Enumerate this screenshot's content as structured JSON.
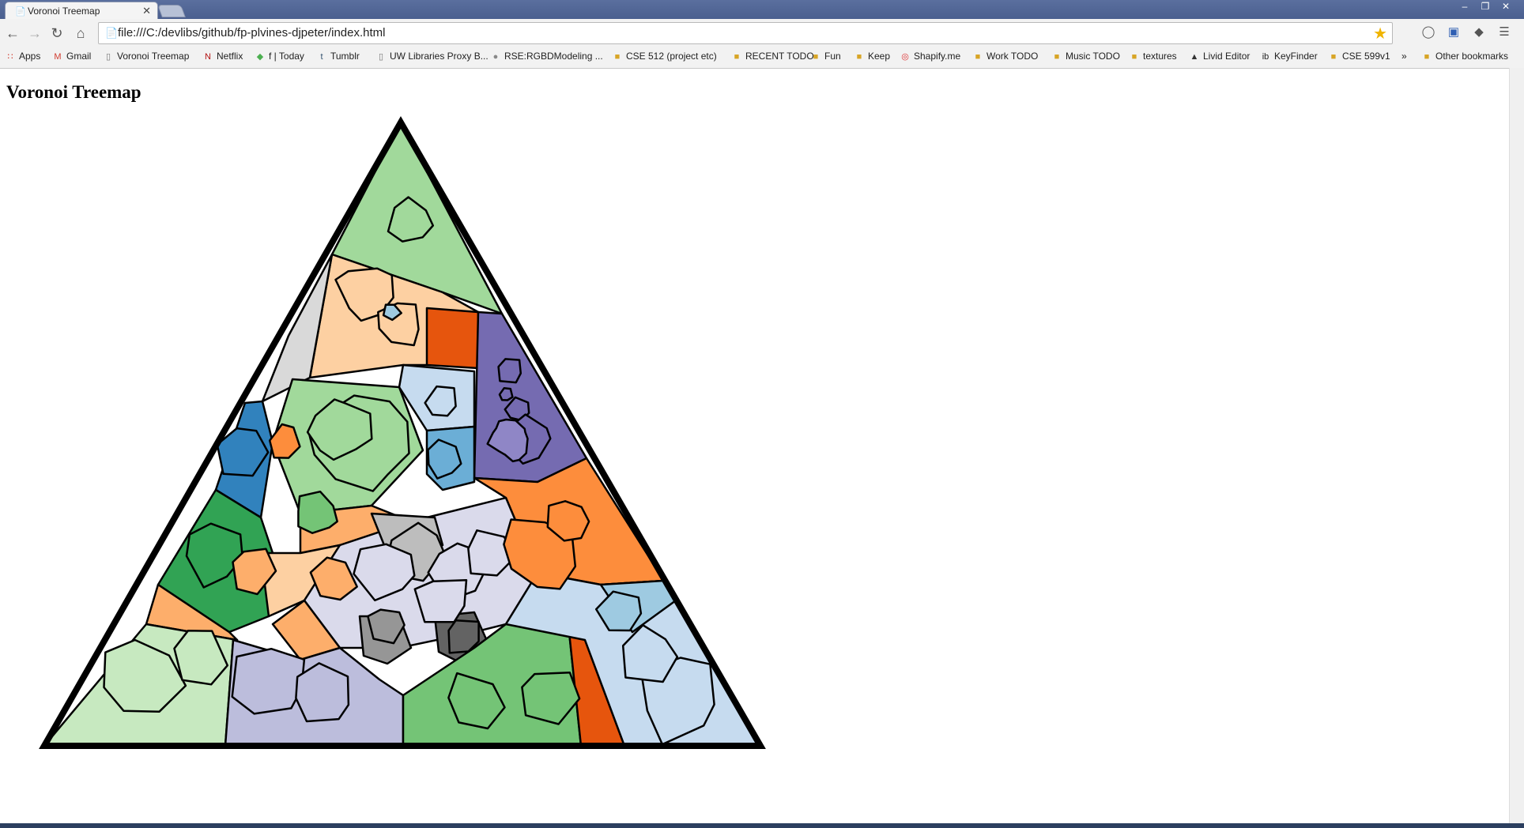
{
  "browser": {
    "tab_title": "Voronoi Treemap",
    "url": "file:///C:/devlibs/github/fp-plvines-djpeter/index.html"
  },
  "bookmarks": [
    {
      "label": "Apps",
      "icon": "apps-grid-icon"
    },
    {
      "label": "Gmail",
      "icon": "gmail-icon"
    },
    {
      "label": "Voronoi Treemap",
      "icon": "page-icon"
    },
    {
      "label": "Netflix",
      "icon": "netflix-icon"
    },
    {
      "label": "f | Today",
      "icon": "feedly-icon"
    },
    {
      "label": "Tumblr",
      "icon": "tumblr-icon"
    },
    {
      "label": "UW Libraries Proxy B...",
      "icon": "page-icon"
    },
    {
      "label": "RSE:RGBDModeling ...",
      "icon": "globe-icon"
    },
    {
      "label": "CSE 512 (project etc)",
      "icon": "folder-icon"
    },
    {
      "label": "RECENT TODO",
      "icon": "folder-icon"
    },
    {
      "label": "Fun",
      "icon": "folder-icon"
    },
    {
      "label": "Keep",
      "icon": "folder-icon"
    },
    {
      "label": "Shapify.me",
      "icon": "shapify-icon"
    },
    {
      "label": "Work TODO",
      "icon": "folder-icon"
    },
    {
      "label": "Music TODO",
      "icon": "folder-icon"
    },
    {
      "label": "textures",
      "icon": "folder-icon"
    },
    {
      "label": "Livid Editor",
      "icon": "livid-icon"
    },
    {
      "label": "KeyFinder",
      "icon": "keyfinder-icon"
    },
    {
      "label": "CSE 599v1",
      "icon": "folder-icon"
    }
  ],
  "bookmarks_overflow": "»",
  "other_bookmarks": "Other bookmarks",
  "page": {
    "heading": "Voronoi Treemap"
  },
  "treemap_palette": {
    "outline": "#000000",
    "colors": [
      "#a1d99b",
      "#fdd0a2",
      "#9ecae1",
      "#e6550d",
      "#756bb1",
      "#d9d9d9",
      "#c6dbef",
      "#3182bd",
      "#fd8d3c",
      "#74c476",
      "#31a354",
      "#6baed6",
      "#dadaeb",
      "#bdbdbd",
      "#969696",
      "#636363",
      "#bcbddc",
      "#c7e9c0",
      "#fdae6b"
    ]
  }
}
